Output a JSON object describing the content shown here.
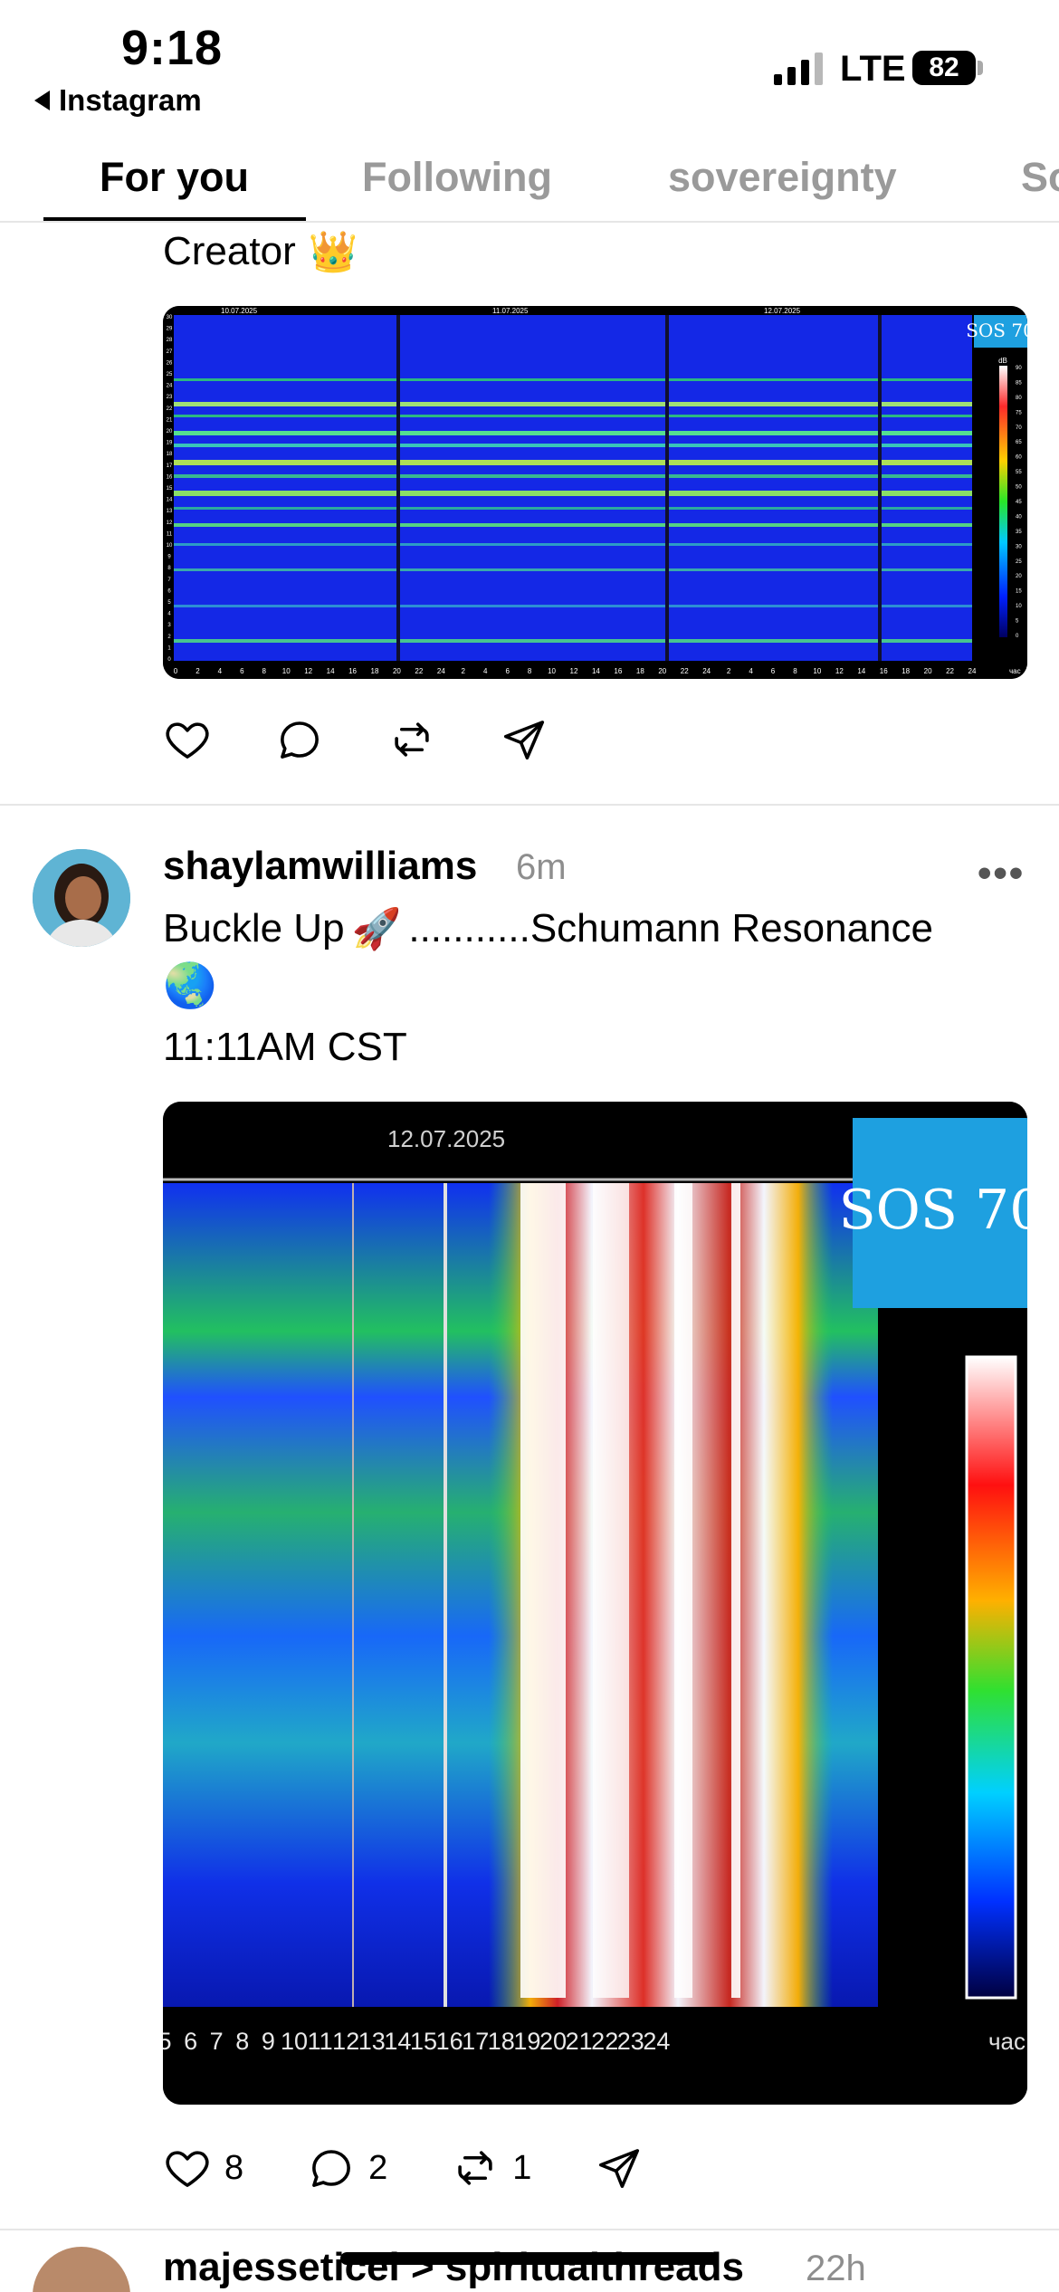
{
  "status_bar": {
    "time": "9:18",
    "back_app": "Instagram",
    "network": "LTE",
    "battery": "82"
  },
  "tabs": [
    {
      "label": "For you",
      "active": true
    },
    {
      "label": "Following",
      "active": false
    },
    {
      "label": "sovereignty",
      "active": false
    },
    {
      "label": "So",
      "active": false
    }
  ],
  "post1": {
    "text": "Creator",
    "emoji": "👑",
    "image": {
      "dates": [
        "10.07.2025",
        "11.07.2025",
        "12.07.2025"
      ],
      "logo": "SOS 70",
      "colorbar_unit": "dB",
      "colorbar_ticks": [
        "90",
        "85",
        "80",
        "75",
        "70",
        "65",
        "60",
        "55",
        "50",
        "45",
        "40",
        "35",
        "30",
        "25",
        "20",
        "15",
        "10",
        "5",
        "0"
      ],
      "hour_ticks": [
        "0",
        "2",
        "4",
        "6",
        "8",
        "10",
        "12",
        "14",
        "16",
        "18",
        "20",
        "22",
        "24",
        "2",
        "4",
        "6",
        "8",
        "10",
        "12",
        "14",
        "16",
        "18",
        "20",
        "22",
        "24",
        "2",
        "4",
        "6",
        "8",
        "10",
        "12",
        "14",
        "16",
        "18",
        "20",
        "22",
        "24"
      ],
      "hour_unit": "час",
      "freq_ticks": [
        "30",
        "29",
        "28",
        "27",
        "26",
        "25",
        "24",
        "23",
        "22",
        "21",
        "20",
        "19",
        "18",
        "17",
        "16",
        "15",
        "14",
        "13",
        "12",
        "11",
        "10",
        "9",
        "8",
        "7",
        "6",
        "5",
        "4",
        "3",
        "2",
        "1",
        "0"
      ]
    },
    "actions": {
      "like_icon": "heart-icon",
      "reply_icon": "comment-icon",
      "repost_icon": "repost-icon",
      "share_icon": "send-icon"
    }
  },
  "post2": {
    "username": "shaylamwilliams",
    "time": "6m",
    "more": "•••",
    "line1": "Buckle Up",
    "line1_emoji": "🚀",
    "line1_rest": "...........Schumann Resonance",
    "line2_emoji": "🌏",
    "line3": "11:11AM CST",
    "image": {
      "date": "12.07.2025",
      "logo": "SOS 70",
      "hour_ticks": [
        "5",
        "6",
        "7",
        "8",
        "9",
        "10",
        "11",
        "12",
        "13",
        "14",
        "15",
        "16",
        "17",
        "18",
        "19",
        "20",
        "21",
        "22",
        "23",
        "24"
      ],
      "hour_unit": "час"
    },
    "counts": {
      "likes": "8",
      "replies": "2",
      "reposts": "1"
    }
  },
  "post3": {
    "username": "majesseticel > spiritualthreads",
    "time": "22h"
  },
  "colors": {
    "tab_inactive": "#9a9a9a",
    "spectro_blue": "#1428e6",
    "logo_blue": "#1ea0e0",
    "divider": "#e6e6e6"
  }
}
